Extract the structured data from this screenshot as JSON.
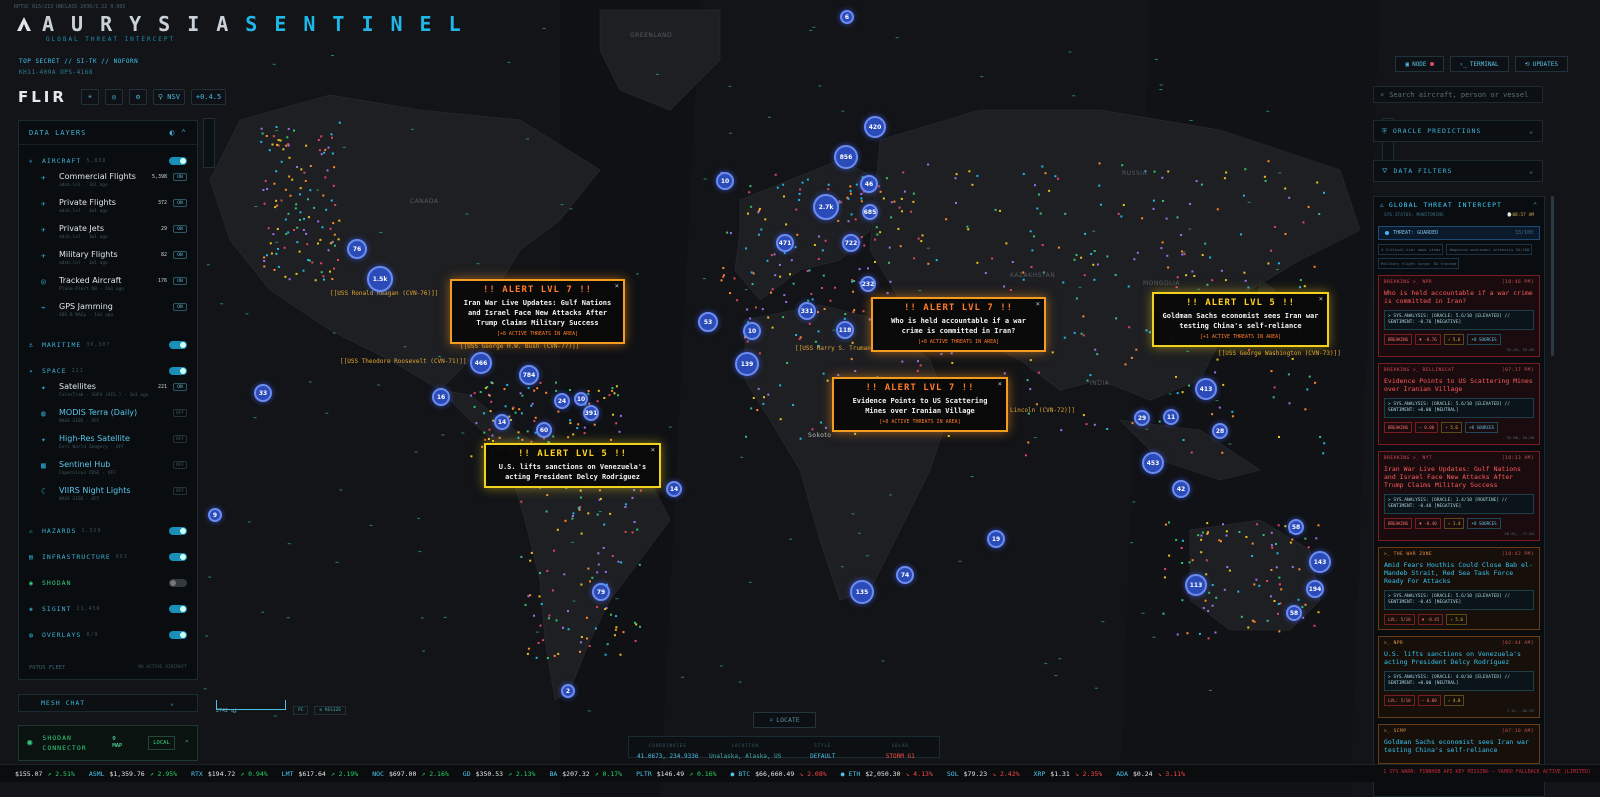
{
  "brand": {
    "word_a": "AURYSIA",
    "word_b": "SENTINEL",
    "subtitle": "GLOBAL THREAT INTERCEPT",
    "tiny": "RPTSC 015/213 UNCLASS 2036/1.22 0.005"
  },
  "classification": {
    "line1": "TOP SECRET // SI-TK // NOFORN",
    "line2": "KH11-409A OPS-4168"
  },
  "toolbar": {
    "mode": "FLIR",
    "buttons": [
      "☀",
      "◎",
      "⚙",
      "⚲ NSV",
      "+0.4.5"
    ]
  },
  "left_panel": {
    "title": "DATA LAYERS",
    "aircraft": {
      "label": "AIRCRAFT",
      "count": "5,838",
      "items": [
        {
          "name": "Commercial Flights",
          "meta": "adsb.lol · 1m1 ago",
          "n": "5,398",
          "state": "ON"
        },
        {
          "name": "Private Flights",
          "meta": "adsb.lol · 1m1 ago",
          "n": "372",
          "state": "ON"
        },
        {
          "name": "Private Jets",
          "meta": "adsb.lol · 1m1 ago",
          "n": "29",
          "state": "ON"
        },
        {
          "name": "Military Flights",
          "meta": "adsb.lol · 1m1 ago",
          "n": "82",
          "state": "ON"
        },
        {
          "name": "Tracked Aircraft",
          "meta": "Plane-Alert DB · 1m1 ago",
          "n": "176",
          "state": "ON"
        },
        {
          "name": "GPS Jamming",
          "meta": "ADS-B NACp · 1m1 ago",
          "n": "",
          "state": "ON"
        }
      ]
    },
    "maritime": {
      "label": "MARITIME",
      "count": "30,307"
    },
    "space": {
      "label": "SPACE",
      "count": "221",
      "items": [
        {
          "name": "Satellites",
          "meta": "CelesTrak · SGP4 (AIS.) · 1m1 ago",
          "n": "221",
          "state": "ON"
        },
        {
          "name": "MODIS Terra (Daily)",
          "meta": "NASA GIBS · OFF",
          "n": "",
          "state": "OFF"
        },
        {
          "name": "High-Res Satellite",
          "meta": "Esri World Imagery · OFF",
          "n": "",
          "state": "OFF"
        },
        {
          "name": "Sentinel Hub",
          "meta": "Copernicus CDSE · OFF",
          "n": "",
          "state": "OFF"
        },
        {
          "name": "VIIRS Night Lights",
          "meta": "NASA GIBS · OFF",
          "n": "",
          "state": "OFF"
        }
      ]
    },
    "groups": [
      {
        "label": "HAZARDS",
        "count": "1,328",
        "on": true
      },
      {
        "label": "INFRASTRUCTURE",
        "count": "863",
        "on": true
      },
      {
        "label": "SHODAN",
        "count": "",
        "on": false
      },
      {
        "label": "SIGINT",
        "count": "21,456",
        "on": true
      },
      {
        "label": "OVERLAYS",
        "count": "8/9",
        "on": true
      }
    ],
    "footer_left": "POTUS FLEET",
    "footer_right": "NO ACTIVE AIRCRAFT"
  },
  "mesh": {
    "label": "MESH CHAT"
  },
  "shodan": {
    "title": "SHODAN CONNECTOR",
    "map_count": "0",
    "map_label": "MAP",
    "link": "LOCAL"
  },
  "scale": {
    "label": "2742 mi",
    "btn1": "PC",
    "btn2": "⊕ RESIZE"
  },
  "right": {
    "buttons": [
      "NODE",
      "TERMINAL",
      "UPDATES"
    ],
    "search_placeholder": "Search aircraft, person or vessel",
    "oracle": "ORACLE PREDICTIONS",
    "filters": "DATA FILTERS",
    "gti": {
      "title": "GLOBAL THREAT INTERCEPT",
      "status": "SYS.STATUS: MONITORING",
      "time": "⌚08:57 AM",
      "threat": "THREAT: GUARDED",
      "threat_r": "33/100",
      "tags": [
        "4 Critical-tier news items",
        "Negative sentiment intensity 94/100",
        "Military flight surge: 82 tracked"
      ],
      "news": [
        {
          "src": "BREAKING ≻_ NPR",
          "time": "[10:46 PM]",
          "hl": "Who is held accountable if a war crime is committed in Iran?",
          "an": "≻ SYS.ANALYSIS: [ORACLE: 5.6/10 [ELEVATED] // SENTIMENT: -0.76 [NEGATIVE]",
          "b": [
            "BREAKING",
            "▼ -0.76",
            "⚡ 5.6",
            "+8 SOURCES"
          ],
          "ft": "32.45, 53.69",
          "style": "red"
        },
        {
          "src": "BREAKING ≻_ BELLINGCAT",
          "time": "[07:17 PM]",
          "hl": "Evidence Points to US Scattering Mines over Iranian Village",
          "an": "≻ SYS.ANALYSIS: [ORACLE: 5.6/10 [ELEVATED] // SENTIMENT: +0.00 [NEUTRAL]",
          "b": [
            "BREAKING",
            "– 0.00",
            "⚡ 5.6",
            "+8 SOURCES"
          ],
          "ft": "32.00, 34.00",
          "style": "red"
        },
        {
          "src": "BREAKING ≻_ NYT",
          "time": "[10:33 AM]",
          "hl": "Iran War Live Updates: Gulf Nations and Israel Face New Attacks After Trump Claims Military Success",
          "an": "≻ SYS.ANALYSIS: [ORACLE: 1.4/10 [ROUTINE] // SENTIMENT: -0.40 [NEGATIVE]",
          "b": [
            "BREAKING",
            "▼ -0.40",
            "⚡ 1.4",
            "+8 SOURCES"
          ],
          "ft": "38.91, -77.04",
          "style": "red"
        },
        {
          "src": "≻_ THE WAR ZONE",
          "time": "[10:42 PM]",
          "hl": "Amid Fears Houthis Could Close Bab el-Mandeb Strait, Red Sea Task Force Ready For Attacks",
          "an": "≻ SYS.ANALYSIS: [ORACLE: 5.6/10 [ELEVATED] // SENTIMENT: -0.45 [NEGATIVE]",
          "b": [
            "LVL: 5/10",
            "▼ -0.45",
            "⚡ 5.6"
          ],
          "ft": "",
          "style": "or"
        },
        {
          "src": "≻_ NPR",
          "time": "[02:44 AM]",
          "hl": "U.S. lifts sanctions on Venezuela's acting President Delcy Rodríguez",
          "an": "≻ SYS.ANALYSIS: [ORACLE: 4.0/10 [ELEVATED] // SENTIMENT: +0.00 [NEUTRAL]",
          "b": [
            "LVL: 5/10",
            "– 0.00",
            "⚡ 4.0"
          ],
          "ft": "7.12, -66.59",
          "style": "or"
        },
        {
          "src": "≻_ SCMP",
          "time": "[07:10 AM]",
          "hl": "Goldman Sachs economist sees Iran war testing China's self-reliance",
          "an": "",
          "b": [],
          "ft": "",
          "style": "or"
        }
      ]
    }
  },
  "alerts": [
    {
      "title": "!! ALERT LVL 7 !!",
      "body": "Iran War Live Updates: Gulf Nations and Israel Face New Attacks After Trump Claims Military Success",
      "sub": "[+8 ACTIVE THREATS IN AREA]",
      "style": "o"
    },
    {
      "title": "!! ALERT LVL 7 !!",
      "body": "Who is held accountable if a war crime is committed in Iran?",
      "sub": "[+8 ACTIVE THREATS IN AREA]",
      "style": "o"
    },
    {
      "title": "!! ALERT LVL 5 !!",
      "body": "Goldman Sachs economist sees Iran war testing China's self-reliance",
      "sub": "[+1 ACTIVE THREATS IN AREA]",
      "style": "y"
    },
    {
      "title": "!! ALERT LVL 7 !!",
      "body": "Evidence Points to US Scattering Mines over Iranian Village",
      "sub": "[+8 ACTIVE THREATS IN AREA]",
      "style": "o"
    },
    {
      "title": "!! ALERT LVL 5 !!",
      "body": "U.S. lifts sanctions on Venezuela's acting President Delcy Rodríguez",
      "sub": "",
      "style": "y"
    }
  ],
  "map_labels": {
    "greenland": "GREENLAND",
    "canada": "CANADA",
    "russia": "RUSSIA",
    "kazakhstan": "KAZAKHSTAN",
    "mongolia": "MONGOLIA",
    "india": "INDIA",
    "sokoto": "Sokoto",
    "carriers": [
      "[[USS Ronald Reagan (CVN-76)]]",
      "[[USS George H.W. Bush (CVN-77)]]",
      "[[USS Theodore Roosevelt (CVN-71)]]",
      "[[USS Harry S. Truman",
      "[[USS George Washington (CVN-73)]]",
      "Lincoln (CVN-72)]]"
    ],
    "clusters": [
      "6",
      "420",
      "856",
      "46",
      "10",
      "76",
      "1.5k",
      "2.7k",
      "685",
      "471",
      "722",
      "53",
      "10",
      "139",
      "466",
      "33",
      "16",
      "784",
      "14",
      "24",
      "60",
      "10",
      "391",
      "331",
      "118",
      "232",
      "413",
      "29",
      "11",
      "28",
      "453",
      "42",
      "14",
      "19",
      "58",
      "143",
      "113",
      "194",
      "135",
      "74",
      "79",
      "2",
      "9",
      "58"
    ]
  },
  "bottom": {
    "locate": "LOCATE",
    "coords_k": "COORDINATES",
    "coords_v": "41.0673, 234.9336",
    "loc_k": "LOCATION",
    "loc_v": "Unalaska, Alaska, US",
    "style_k": "STYLE",
    "style_v": "DEFAULT",
    "solar_k": "SOLAR",
    "solar_v": "STORM G1"
  },
  "ticker": [
    {
      "s": "",
      "p": "$155.07",
      "c": "↗ 2.51%",
      "up": true
    },
    {
      "s": "ASML",
      "p": "$1,359.76",
      "c": "↗ 2.95%",
      "up": true
    },
    {
      "s": "RTX",
      "p": "$194.72",
      "c": "↗ 0.94%",
      "up": true
    },
    {
      "s": "LMT",
      "p": "$617.64",
      "c": "↗ 2.19%",
      "up": true
    },
    {
      "s": "NOC",
      "p": "$697.00",
      "c": "↗ 2.16%",
      "up": true
    },
    {
      "s": "GD",
      "p": "$350.53",
      "c": "↗ 2.13%",
      "up": true
    },
    {
      "s": "BA",
      "p": "$207.32",
      "c": "↗ 0.17%",
      "up": true
    },
    {
      "s": "PLTR",
      "p": "$146.49",
      "c": "↗ 0.16%",
      "up": true
    },
    {
      "s": "● BTC",
      "p": "$66,660.49",
      "c": "↘ 2.08%",
      "up": false
    },
    {
      "s": "● ETH",
      "p": "$2,050.30",
      "c": "↘ 4.13%",
      "up": false
    },
    {
      "s": "SOL",
      "p": "$79.23",
      "c": "↘ 2.42%",
      "up": false
    },
    {
      "s": "XRP",
      "p": "$1.31",
      "c": "↘ 2.35%",
      "up": false
    },
    {
      "s": "ADA",
      "p": "$0.24",
      "c": "↘ 3.11%",
      "up": false
    }
  ],
  "ticker_right": "1 SYS WARN: FINNHUB API KEY MISSING — YAHOO FALLBACK ACTIVE (LIMITED)"
}
